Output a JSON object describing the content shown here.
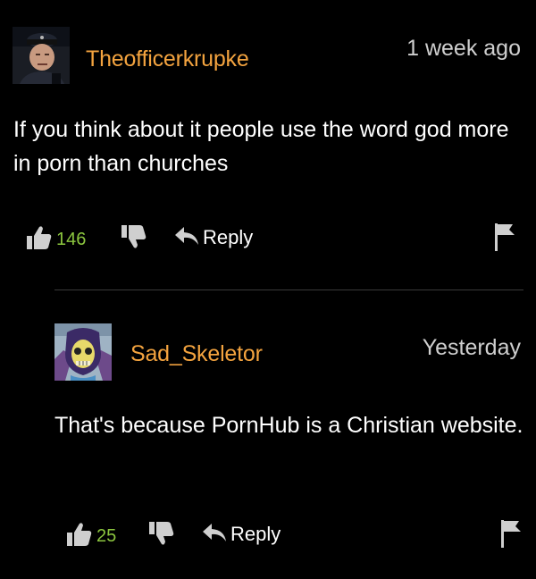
{
  "colors": {
    "background": "#000000",
    "username": "#f3a33f",
    "like_count": "#8cc63f",
    "text": "#ffffff",
    "timestamp": "#cfcfcf",
    "icon": "#cfcfcf",
    "divider": "#3a3a3a"
  },
  "comments": [
    {
      "avatar_icon": "user-avatar-photo",
      "username": "Theofficerkrupke",
      "timestamp": "1 week ago",
      "text": "If you think about it people use the word god more in porn than churches",
      "likes": "146",
      "reply_label": "Reply"
    },
    {
      "avatar_icon": "skeletor-avatar",
      "username": "Sad_Skeletor",
      "timestamp": "Yesterday",
      "text": "That's because PornHub is a Christian website.",
      "likes": "25",
      "reply_label": "Reply"
    }
  ]
}
